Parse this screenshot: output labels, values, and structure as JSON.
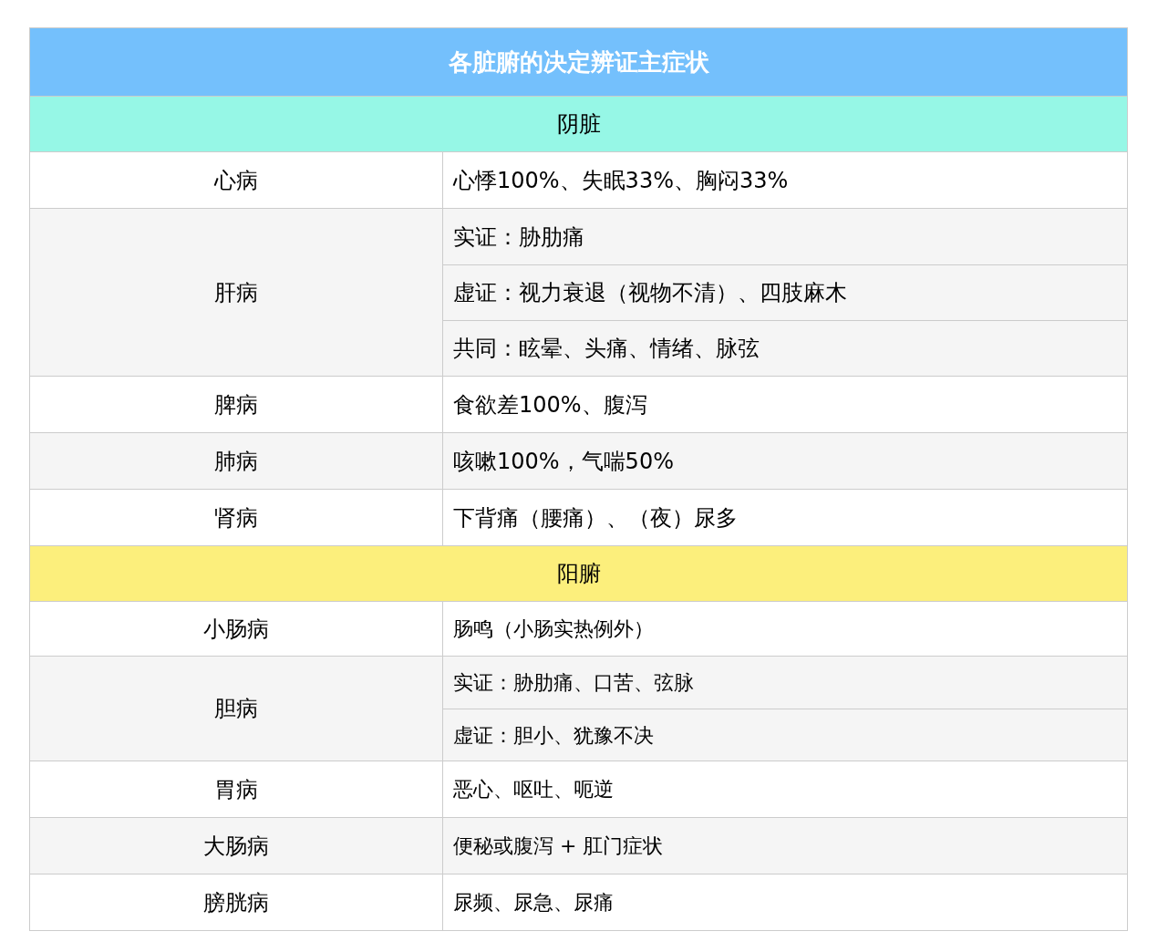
{
  "title": "各脏腑的决定辨证主症状",
  "sections": [
    {
      "title": "阴脏",
      "color": "#96f7e6",
      "rows": [
        {
          "organ": "心病",
          "symptoms": [
            "心悸100%、失眠33%、胸闷33%"
          ]
        },
        {
          "organ": "肝病",
          "symptoms": [
            "实证：胁肋痛",
            "虚证：视力衰退（视物不清）、四肢麻木",
            "共同：眩晕、头痛、情绪、脉弦"
          ]
        },
        {
          "organ": "脾病",
          "symptoms": [
            "食欲差100%、腹泻"
          ]
        },
        {
          "organ": "肺病",
          "symptoms": [
            "咳嗽100%，气喘50%"
          ]
        },
        {
          "organ": "肾病",
          "symptoms": [
            "下背痛（腰痛）、（夜）尿多"
          ]
        }
      ]
    },
    {
      "title": "阳腑",
      "color": "#fcef7c",
      "rows": [
        {
          "organ": "小肠病",
          "symptoms": [
            "肠鸣（小肠实热例外）"
          ]
        },
        {
          "organ": "胆病",
          "symptoms": [
            "实证：胁肋痛、口苦、弦脉",
            "虚证：胆小、犹豫不决"
          ]
        },
        {
          "organ": "胃病",
          "symptoms": [
            "恶心、呕吐、呃逆"
          ]
        },
        {
          "organ": "大肠病",
          "symptoms": [
            "便秘或腹泻 + 肛门症状"
          ]
        },
        {
          "organ": "膀胱病",
          "symptoms": [
            "尿频、尿急、尿痛"
          ]
        }
      ]
    }
  ]
}
